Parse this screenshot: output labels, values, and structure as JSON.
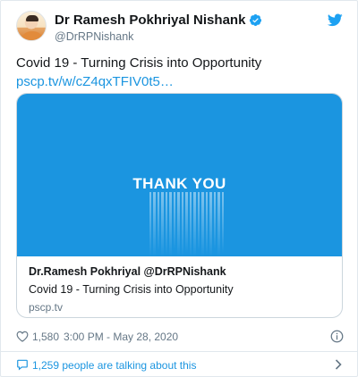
{
  "header": {
    "display_name": "Dr Ramesh Pokhriyal Nishank",
    "handle": "@DrRPNishank",
    "verified_icon": "verified-badge-icon",
    "logo_icon": "twitter-bird-icon"
  },
  "tweet": {
    "text": "Covid 19 - Turning Crisis into Opportunity ",
    "link_text": "pscp.tv/w/cZ4qxTFIV0t5…"
  },
  "card": {
    "image_text": "THANK YOU",
    "title": "Dr.Ramesh Pokhriyal @DrRPNishank",
    "description": "Covid 19 - Turning Crisis into Opportunity",
    "domain": "pscp.tv"
  },
  "footer": {
    "likes": "1,580",
    "timestamp": "3:00 PM - May 28, 2020",
    "talking": "1,259 people are talking about this"
  },
  "colors": {
    "accent": "#1b95e0",
    "media_background": "#1b95e0",
    "secondary_text": "#657786",
    "border": "#e1e8ed"
  }
}
